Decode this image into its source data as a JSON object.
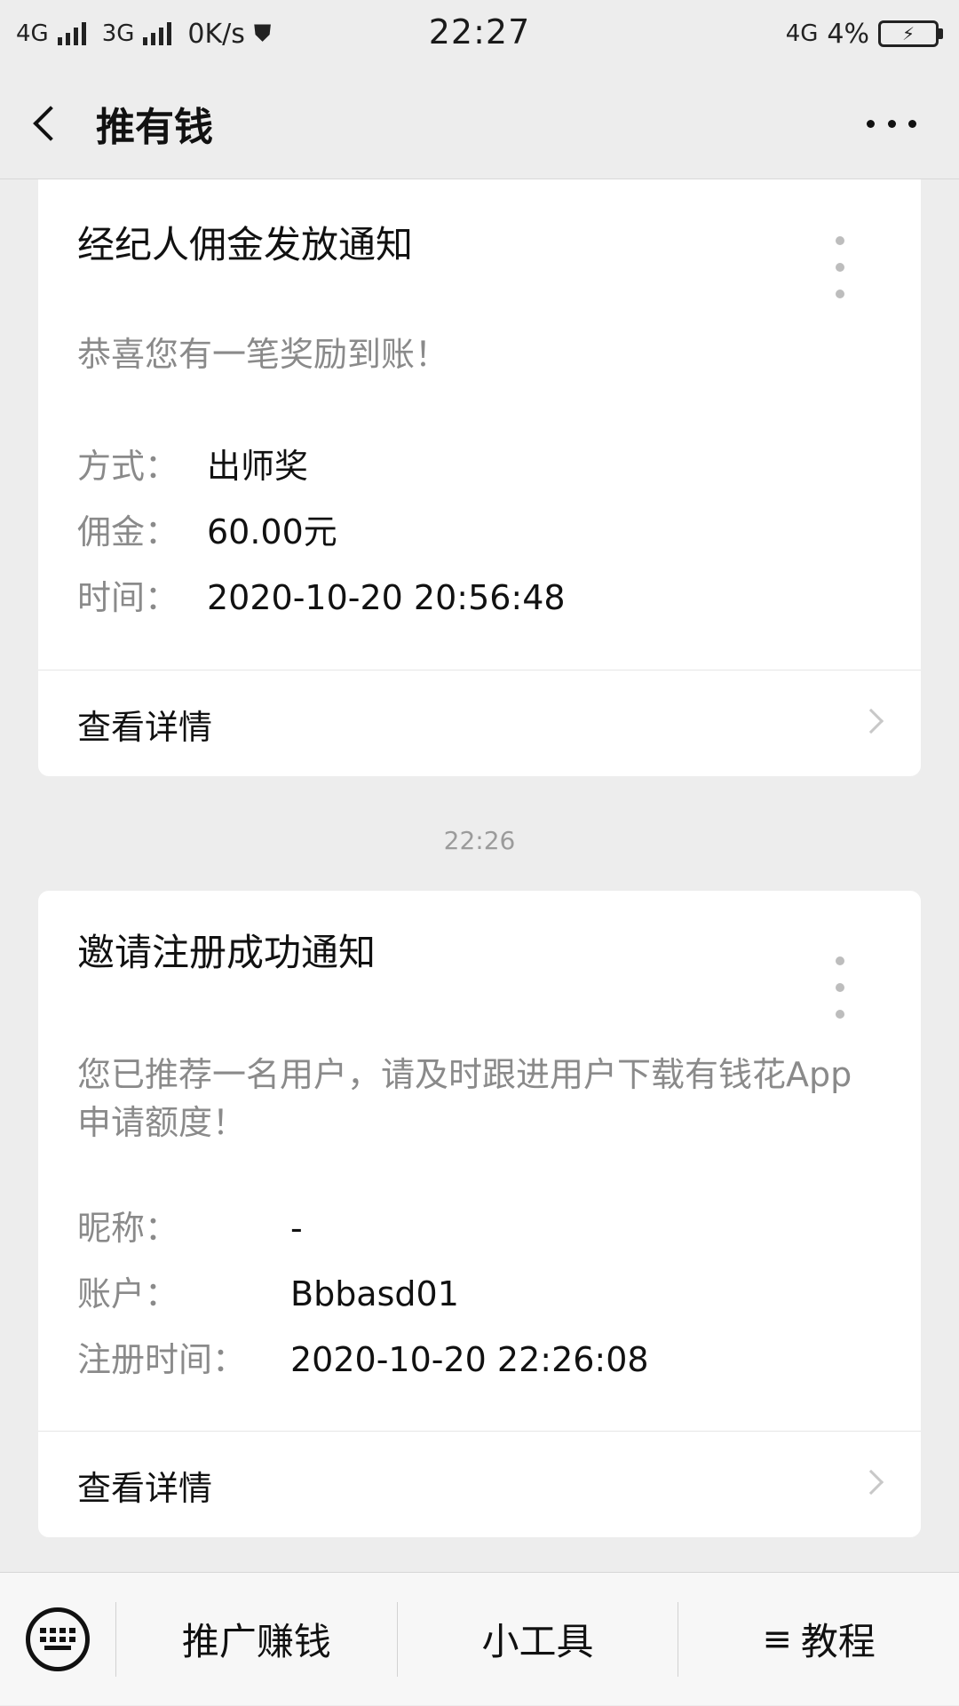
{
  "status_bar": {
    "net1": "4G",
    "net2": "3G",
    "speed": "0K/s",
    "time": "22:27",
    "net3": "4G",
    "battery_percent": "4%"
  },
  "header": {
    "title": "推有钱"
  },
  "messages": [
    {
      "title": "经纪人佣金发放通知",
      "description": "恭喜您有一笔奖励到账！",
      "fields": [
        {
          "label": "方式：",
          "value": "出师奖"
        },
        {
          "label": "佣金：",
          "value": "60.00元"
        },
        {
          "label": "时间：",
          "value": "2020-10-20 20:56:48"
        }
      ],
      "link_label": "查看详情"
    },
    {
      "title": "邀请注册成功通知",
      "description": "您已推荐一名用户，请及时跟进用户下载有钱花App申请额度！",
      "fields": [
        {
          "label": "昵称：",
          "value": "-"
        },
        {
          "label": "账户：",
          "value": "Bbbasd01"
        },
        {
          "label": "注册时间：",
          "value": "2020-10-20 22:26:08"
        }
      ],
      "link_label": "查看详情"
    }
  ],
  "timestamp": "22:26",
  "bottom_menu": {
    "item1": "推广赚钱",
    "item2": "小工具",
    "item3": "教程",
    "item3_glyph": "≡"
  }
}
